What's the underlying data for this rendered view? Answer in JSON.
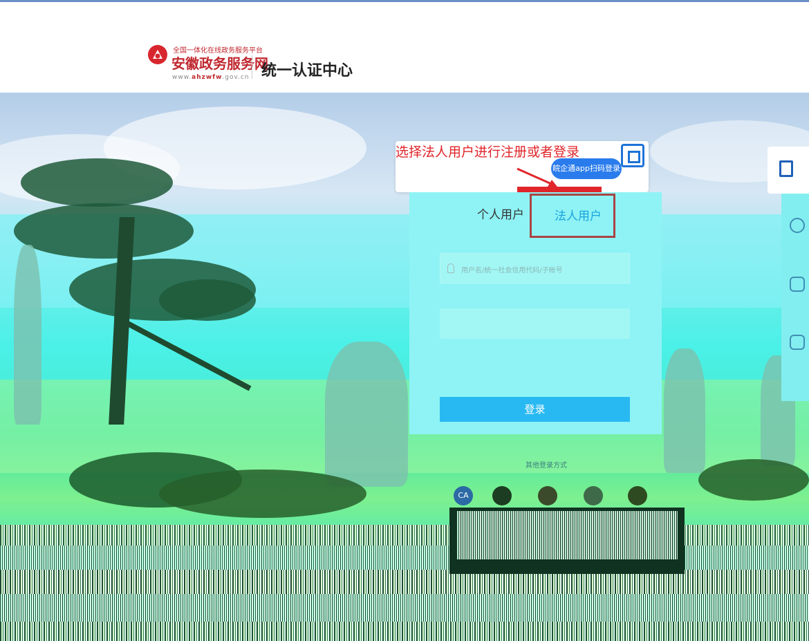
{
  "header": {
    "brand_small": "全国一体化在线政务服务平台",
    "brand_main": "安徽政务服务网",
    "brand_url_prefix": "www.",
    "brand_url_bold": "ahzwfw",
    "brand_url_suffix": ".gov.cn",
    "center_title": "统一认证中心"
  },
  "annotation": {
    "text": "选择法人用户进行注册或者登录",
    "color": "#e0262a"
  },
  "qr_login": {
    "badge": "皖企通app扫码登录"
  },
  "login": {
    "tabs": [
      {
        "label": "个人用户",
        "active": false
      },
      {
        "label": "法人用户",
        "active": true
      }
    ],
    "username_placeholder": "用户名/统一社会信用代码/子帐号",
    "login_button": "登录",
    "other_methods_label": "其他登录方式",
    "ca_label": "CA"
  },
  "colors": {
    "brand_red": "#c0282f",
    "accent_blue": "#29b9f2",
    "active_tab": "#19a3dd"
  }
}
